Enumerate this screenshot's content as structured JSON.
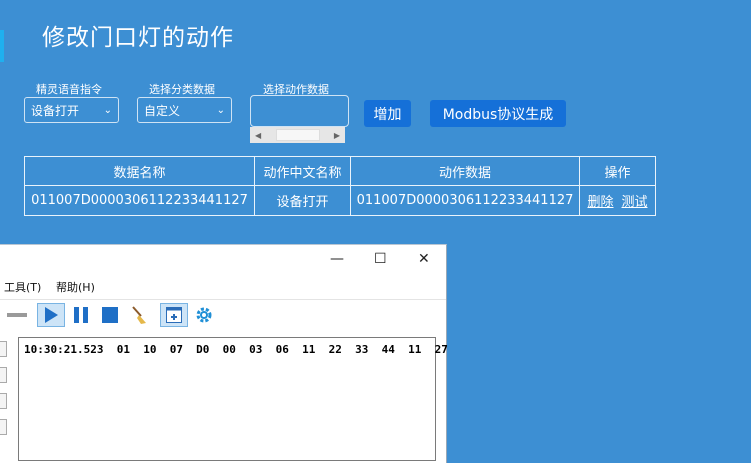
{
  "page": {
    "title": "修改门口灯的动作"
  },
  "form": {
    "voice_command": {
      "label": "精灵语音指令",
      "value": "设备打开"
    },
    "category": {
      "label": "选择分类数据",
      "value": "自定义"
    },
    "action_data": {
      "label": "选择动作数据"
    },
    "add_button": "增加",
    "modbus_button": "Modbus协议生成"
  },
  "table": {
    "headers": [
      "数据名称",
      "动作中文名称",
      "动作数据",
      "操作"
    ],
    "rows": [
      {
        "name": "011007D0000306112233441127",
        "cn_name": "设备打开",
        "data": "011007D0000306112233441127",
        "actions": [
          "删除",
          "测试"
        ]
      }
    ]
  },
  "tool_window": {
    "controls": {
      "minimize": "—",
      "maximize": "☐",
      "close": "✕"
    },
    "menu": [
      "工具(T)",
      "帮助(H)"
    ],
    "toolbar_icons": [
      "minus-icon",
      "play-icon",
      "pause-icon",
      "stop-icon",
      "broom-icon",
      "window-icon",
      "gear-icon"
    ],
    "log_line": "10:30:21.523  01  10  07  D0  00  03  06  11  22  33  44  11  27"
  }
}
